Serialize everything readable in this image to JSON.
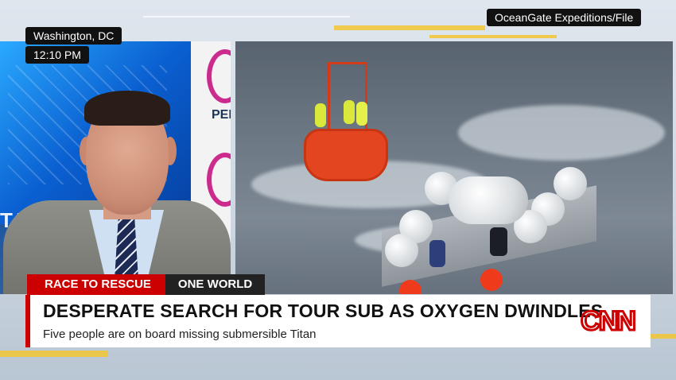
{
  "location": "Washington, DC",
  "time": "12:10 PM",
  "credit": "OceanGate Expeditions/File",
  "studio": {
    "wall_text": "TAGON",
    "sign_text": "PEN"
  },
  "chyron": {
    "tag_primary": "RACE TO RESCUE",
    "tag_secondary": "ONE WORLD",
    "headline": "DESPERATE SEARCH FOR TOUR SUB AS OXYGEN DWINDLES",
    "subline": "Five people are on board missing submersible Titan"
  },
  "logo": {
    "text": "CNN",
    "color": "#cc0000"
  },
  "colors": {
    "accent_red": "#cc0000",
    "accent_yellow": "#f2c531"
  },
  "icons": [
    "cnn-logo-icon",
    "lapel-mic-icon"
  ]
}
